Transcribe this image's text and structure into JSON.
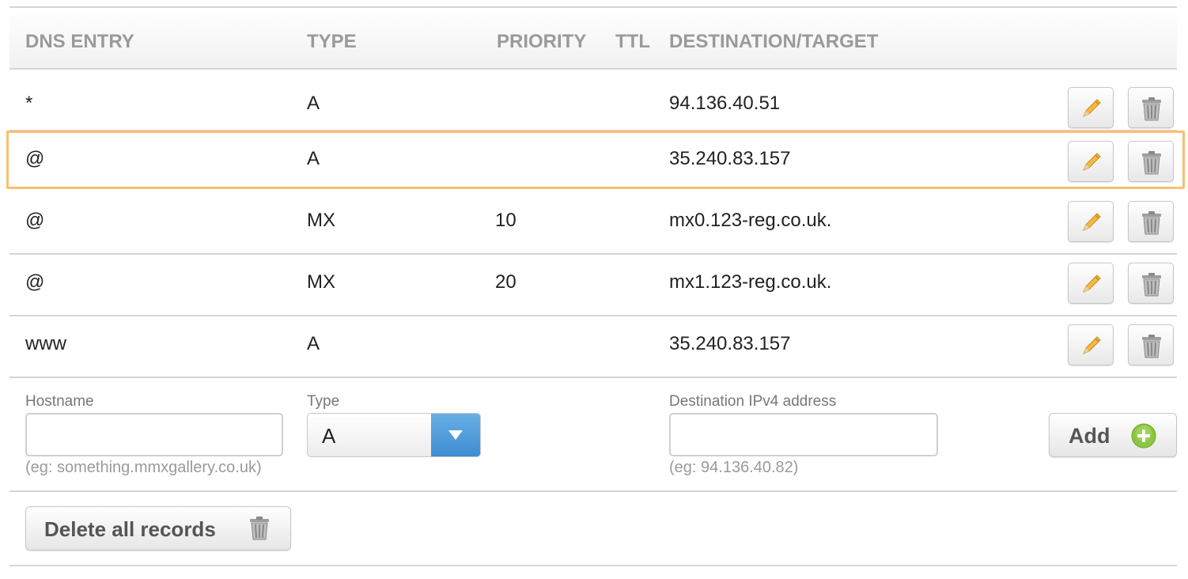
{
  "table": {
    "columns": {
      "dns_entry": "DNS ENTRY",
      "type": "TYPE",
      "priority": "PRIORITY",
      "ttl": "TTL",
      "destination": "DESTINATION/TARGET"
    },
    "rows": [
      {
        "entry": "*",
        "type": "A",
        "priority": "",
        "ttl": "",
        "destination": "94.136.40.51"
      },
      {
        "entry": "@",
        "type": "A",
        "priority": "",
        "ttl": "",
        "destination": "35.240.83.157",
        "highlighted": true
      },
      {
        "entry": "@",
        "type": "MX",
        "priority": "10",
        "ttl": "",
        "destination": "mx0.123-reg.co.uk."
      },
      {
        "entry": "@",
        "type": "MX",
        "priority": "20",
        "ttl": "",
        "destination": "mx1.123-reg.co.uk."
      },
      {
        "entry": "www",
        "type": "A",
        "priority": "",
        "ttl": "",
        "destination": "35.240.83.157"
      }
    ],
    "row_actions": {
      "edit_icon": "pencil-icon",
      "delete_icon": "trash-icon"
    }
  },
  "add_form": {
    "hostname": {
      "label": "Hostname",
      "value": "",
      "hint": "(eg: something.mmxgallery.co.uk)"
    },
    "type": {
      "label": "Type",
      "selected": "A"
    },
    "destination": {
      "label": "Destination IPv4 address",
      "value": "",
      "hint": "(eg: 94.136.40.82)"
    },
    "add_button": {
      "label": "Add",
      "icon": "plus-circle-icon"
    }
  },
  "delete_all_button": {
    "label": "Delete all records",
    "icon": "trash-icon"
  },
  "colors": {
    "highlight_border": "#f9c06f",
    "header_text": "#9a9a9a",
    "select_arrow": "#4a95d6",
    "add_icon": "#8cc63f"
  }
}
